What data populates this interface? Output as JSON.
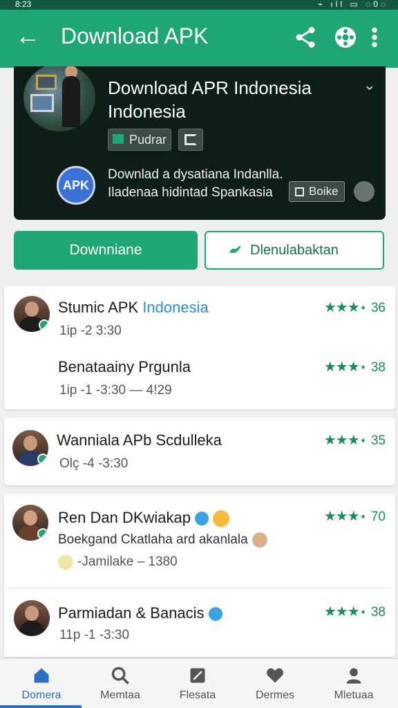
{
  "status_bar": {
    "time": "8:23",
    "icons": "⌁ ıll ▭ ◌0◌"
  },
  "app_bar": {
    "title": "Download APK",
    "back_icon": "arrow-left-icon",
    "actions": [
      "share-icon",
      "globe-icon",
      "more-vert-icon"
    ]
  },
  "hero": {
    "title": "Download APR Indonesia Indonesia",
    "chip_label": "Pudrar",
    "badge_text": "APK",
    "description": "Downlad a dysatiana Indanlla. Iladenaa hidintad Spankasia",
    "boike_label": "Boike"
  },
  "buttons": {
    "primary": "Downniane",
    "secondary": "Dlenulabaktan"
  },
  "items": [
    {
      "name": "Stumic APK ",
      "name_accent": "Indonesia",
      "meta": "1ip -2  3:30",
      "rating": "36"
    },
    {
      "name": "Benataainy Prgunla",
      "meta": "1ip -1 -3:30  — 4!29",
      "rating": "38"
    },
    {
      "name": "Wanniala APb Scdulleka",
      "meta": "Olç -4 -3:30",
      "rating": "35"
    },
    {
      "name": "Ren Dan DKwiakap",
      "sub": "Boekgand Ckatlaha ard akanlala",
      "meta": "-Jamilake  – 1380",
      "rating": "70"
    },
    {
      "name": "Parmiadan & Banacis",
      "meta": "11p -1 -3:30",
      "rating": "38"
    }
  ],
  "stars": "★★★",
  "star_half": "⋆",
  "bottom_nav": [
    {
      "label": "Domera",
      "icon": "home-icon",
      "active": true
    },
    {
      "label": "Memtaa",
      "icon": "search-icon"
    },
    {
      "label": "Flesata",
      "icon": "image-icon"
    },
    {
      "label": "Dermes",
      "icon": "heart-icon"
    },
    {
      "label": "Mletuaa",
      "icon": "profile-icon"
    }
  ],
  "colors": {
    "brand": "#1ea774",
    "hero_bg": "#0f1d18",
    "accent_blue": "#2a72c0"
  }
}
